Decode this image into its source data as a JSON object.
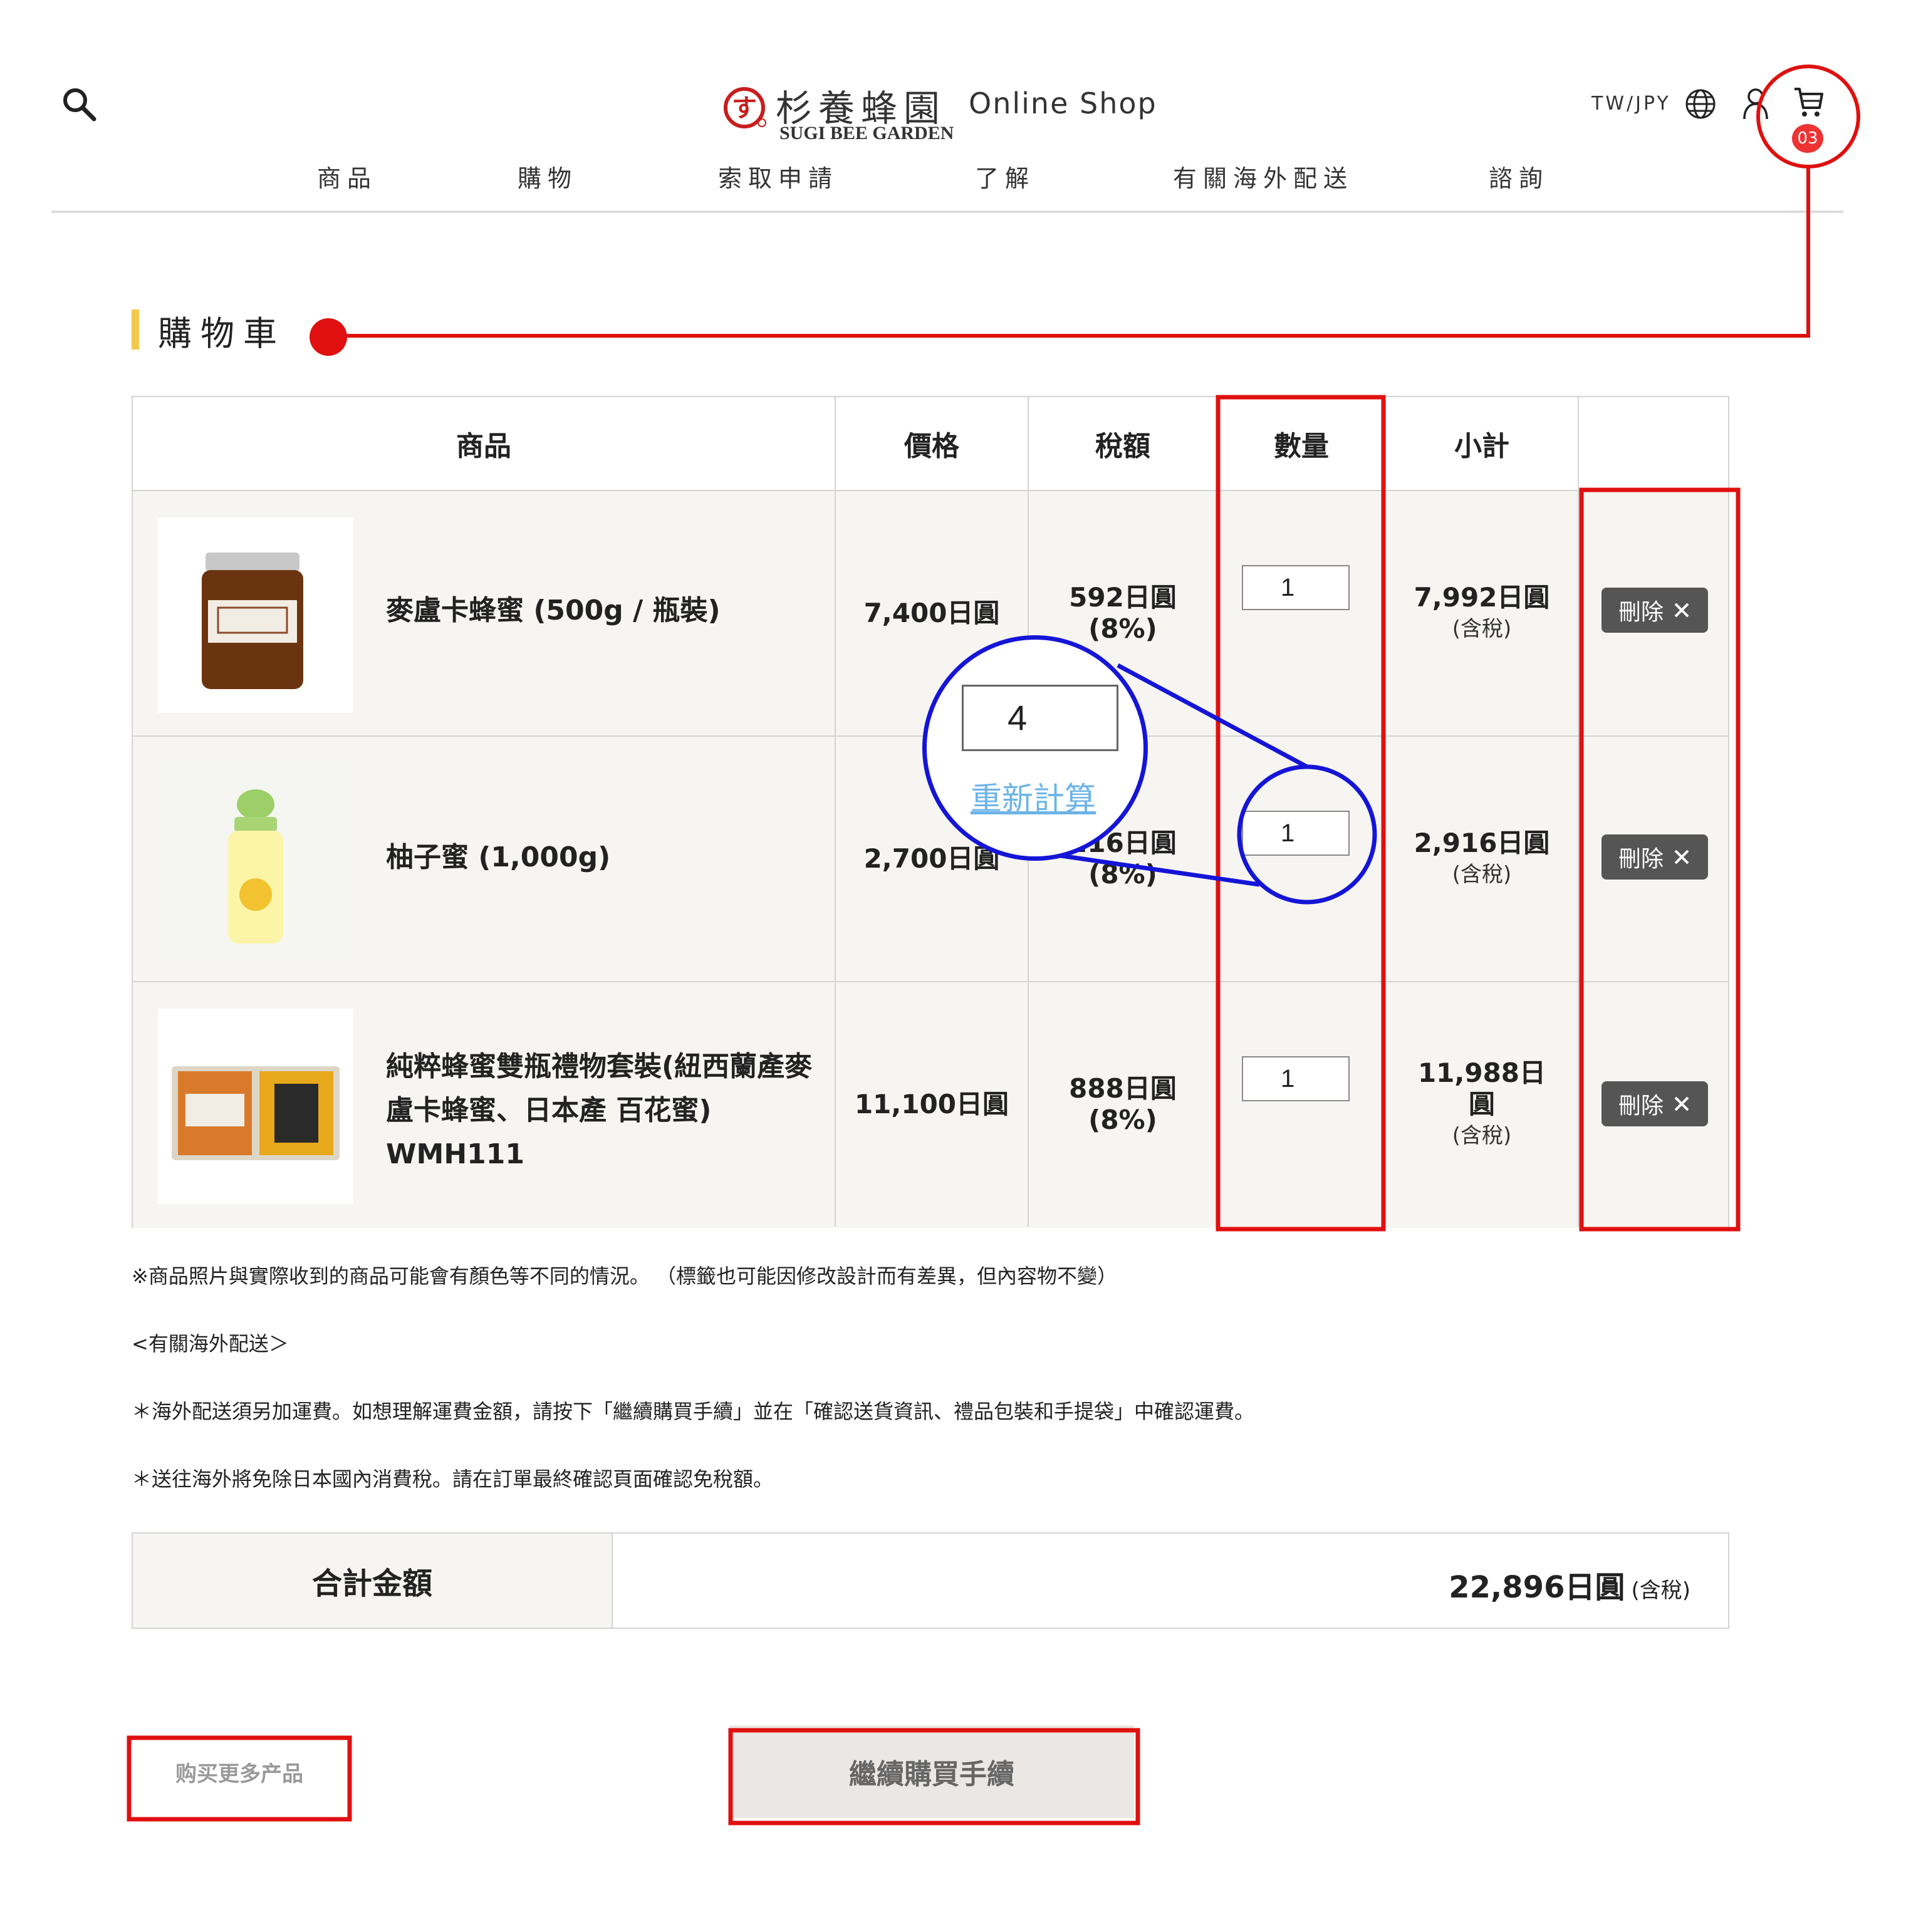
{
  "header": {
    "logo_jp": "杉養蜂園",
    "logo_en": "SUGI BEE GARDEN",
    "shop_label": "Online Shop",
    "currency": "TW/JPY",
    "cart_count": "03",
    "nav": [
      "商品",
      "購物",
      "索取申請",
      "了解",
      "有關海外配送",
      "諮詢"
    ]
  },
  "page_title": "購物車",
  "table": {
    "headers": {
      "product": "商品",
      "price": "價格",
      "tax": "稅額",
      "qty": "數量",
      "subtotal": "小計"
    },
    "rows": [
      {
        "name": "麥盧卡蜂蜜 (500g / 瓶裝)",
        "price": "7,400日圓",
        "tax": "592日圓",
        "tax_rate": "(8%)",
        "qty": "1",
        "subtotal": "7,992日圓",
        "subtotal_note": "(含稅)",
        "delete_label": "刪除"
      },
      {
        "name": "柚子蜜 (1,000g)",
        "price": "2,700日圓",
        "tax": "216日圓",
        "tax_rate": "(8%)",
        "qty": "1",
        "subtotal": "2,916日圓",
        "subtotal_note": "(含稅)",
        "delete_label": "刪除"
      },
      {
        "name": "純粹蜂蜜雙瓶禮物套裝(紐西蘭產麥盧卡蜂蜜、日本產 百花蜜) WMH111",
        "price": "11,100日圓",
        "tax": "888日圓",
        "tax_rate": "(8%)",
        "qty": "1",
        "subtotal": "11,988日圓",
        "subtotal_note": "(含稅)",
        "delete_label": "刪除"
      }
    ]
  },
  "notes": {
    "photo": "※商品照片與實際收到的商品可能會有顏色等不同的情況。 （標籤也可能因修改設計而有差異，但內容物不變）",
    "overseas_heading": "<有關海外配送＞",
    "shipping": "＊海外配送須另加運費。如想理解運費金額，請按下「繼續購買手續」並在「確認送貨資訊、禮品包裝和手提袋」中確認運費。",
    "tax_free": "＊送往海外將免除日本國內消費稅。請在訂單最終確認頁面確認免稅額。"
  },
  "total": {
    "label": "合計金額",
    "value": "22,896日圓",
    "note": "(含稅)"
  },
  "buttons": {
    "more": "购买更多产品",
    "continue": "繼續購買手續"
  },
  "magnifier": {
    "qty_value": "4",
    "recalc_label": "重新計算"
  },
  "colors": {
    "annotation_red": "#e01010",
    "annotation_blue": "#1515d8",
    "row_background": "#f6f5f2",
    "title_accent": "#f2c94c",
    "delete_button": "#555555"
  }
}
